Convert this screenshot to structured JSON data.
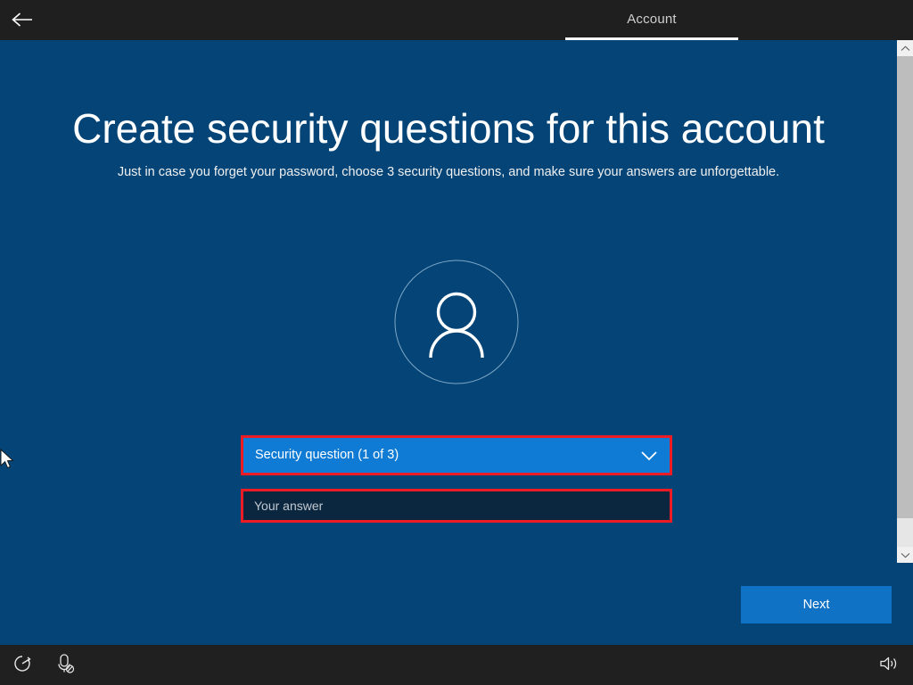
{
  "window": {
    "topbar": {
      "back_icon": "back-arrow-icon",
      "tab_label": "Account"
    }
  },
  "main": {
    "title": "Create security questions for this account",
    "subtitle": "Just in case you forget your password, choose 3 security questions, and make sure your answers are unforgettable.",
    "avatar_icon": "user-avatar-icon",
    "form": {
      "question_select_value": "Security question (1 of 3)",
      "question_select_chevron": "chevron-down-icon",
      "answer_value": "",
      "answer_placeholder": "Your answer",
      "highlight_color": "#ed1c24"
    },
    "next_button_label": "Next"
  },
  "scrollbar": {
    "up_arrow_icon": "chevron-up-icon",
    "down_arrow_icon": "chevron-down-icon"
  },
  "taskbar": {
    "power_icon": "power-ease-of-access-icon",
    "narrator_icon": "narrator-muted-icon",
    "volume_icon": "speaker-volume-icon"
  },
  "colors": {
    "background": "#044477",
    "chrome": "#1f1f1f",
    "taskbar": "#202020",
    "accent": "#0f7bd4",
    "button": "#0f72c4",
    "field_fill": "#0b2740",
    "highlight": "#ed1c24"
  }
}
